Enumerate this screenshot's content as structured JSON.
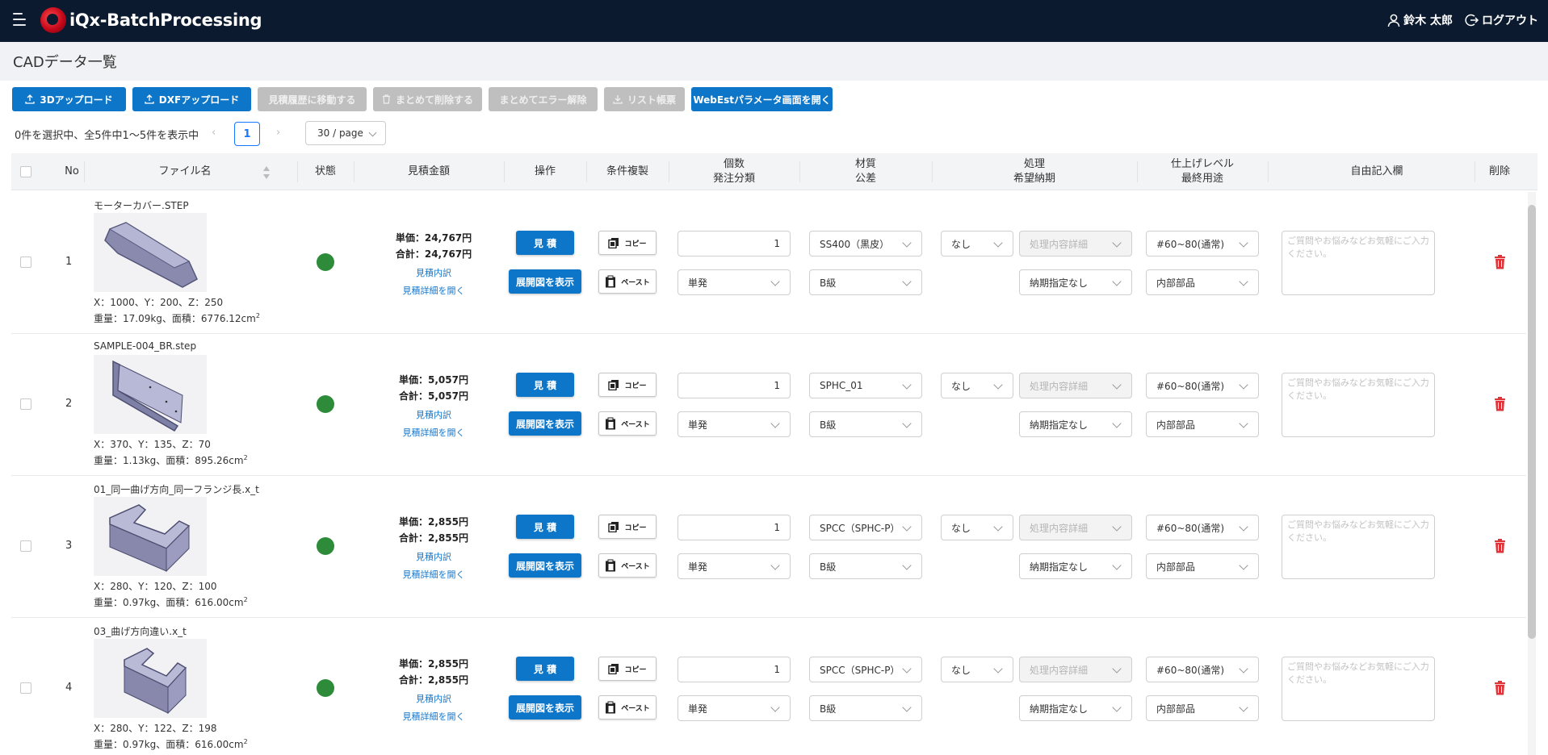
{
  "header": {
    "app_name": "iQx-BatchProcessing",
    "user_name": "鈴木 太郎",
    "logout_label": "ログアウト"
  },
  "page": {
    "title": "CADデータ一覧"
  },
  "toolbar": {
    "upload_3d": "3Dアップロード",
    "upload_dxf": "DXFアップロード",
    "move_history": "見積履歴に移動する",
    "bulk_delete": "まとめて削除する",
    "bulk_clear_error": "まとめてエラー解除",
    "list_report": "リスト帳票",
    "webest_params": "WebEstパラメータ画面を開く"
  },
  "pagination": {
    "summary": "0件を選択中、全5件中1〜5件を表示中",
    "current_page": "1",
    "page_size": "30 / page"
  },
  "table": {
    "headers": {
      "no": "No",
      "file_name": "ファイル名",
      "status": "状態",
      "estimate_amount": "見積金額",
      "operation": "操作",
      "copy_condition": "条件複製",
      "qty": "個数",
      "order_type": "発注分類",
      "material": "材質",
      "tolerance": "公差",
      "process": "処理",
      "due_date": "希望納期",
      "finish_level": "仕上げレベル",
      "final_use": "最終用途",
      "free_text": "自由記入欄",
      "delete": "削除"
    },
    "rows": [
      {
        "no": "1",
        "file_name": "モーターカバー.STEP",
        "dims": "X：1000、Y：200、Z：250",
        "weight_area": "重量：17.09kg、面積：6776.12cm",
        "unit_price": "単価：24,767円",
        "total_price": "合計：24,767円",
        "qty": "1",
        "order_type": "単発",
        "material": "SS400（黒皮）",
        "tolerance": "B級",
        "process": "なし",
        "process_detail": "処理内容詳細",
        "due": "納期指定なし",
        "finish": "#60~80(通常)",
        "use": "内部部品"
      },
      {
        "no": "2",
        "file_name": "SAMPLE-004_BR.step",
        "dims": "X：370、Y：135、Z：70",
        "weight_area": "重量：1.13kg、面積：895.26cm",
        "unit_price": "単価：5,057円",
        "total_price": "合計：5,057円",
        "qty": "1",
        "order_type": "単発",
        "material": "SPHC_01",
        "tolerance": "B級",
        "process": "なし",
        "process_detail": "処理内容詳細",
        "due": "納期指定なし",
        "finish": "#60~80(通常)",
        "use": "内部部品"
      },
      {
        "no": "3",
        "file_name": "01_同一曲げ方向_同一フランジ長.x_t",
        "dims": "X：280、Y：120、Z：100",
        "weight_area": "重量：0.97kg、面積：616.00cm",
        "unit_price": "単価：2,855円",
        "total_price": "合計：2,855円",
        "qty": "1",
        "order_type": "単発",
        "material": "SPCC（SPHC-P）",
        "tolerance": "B級",
        "process": "なし",
        "process_detail": "処理内容詳細",
        "due": "納期指定なし",
        "finish": "#60~80(通常)",
        "use": "内部部品"
      },
      {
        "no": "4",
        "file_name": "03_曲げ方向違い.x_t",
        "dims": "X：280、Y：122、Z：198",
        "weight_area": "重量：0.97kg、面積：616.00cm",
        "unit_price": "単価：2,855円",
        "total_price": "合計：2,855円",
        "qty": "1",
        "order_type": "単発",
        "material": "SPCC（SPHC-P）",
        "tolerance": "B級",
        "process": "なし",
        "process_detail": "処理内容詳細",
        "due": "納期指定なし",
        "finish": "#60~80(通常)",
        "use": "内部部品"
      }
    ],
    "common": {
      "area_unit_sup": "2",
      "estimate_detail_link": "見積内訳",
      "open_detail_link": "見積詳細を開く",
      "estimate_btn": "見 積",
      "show_unfold_btn": "展開図を表示",
      "copy_btn": "コピー",
      "paste_btn": "ペースト",
      "free_text_placeholder": "ご質問やお悩みなどお気軽にご入力ください。"
    }
  },
  "colors": {
    "header_bg": "#0b1a2e",
    "primary": "#0d76c8",
    "disabled": "#bfbfbf",
    "status_ok": "#2e8b3a",
    "delete": "#e0343a"
  }
}
